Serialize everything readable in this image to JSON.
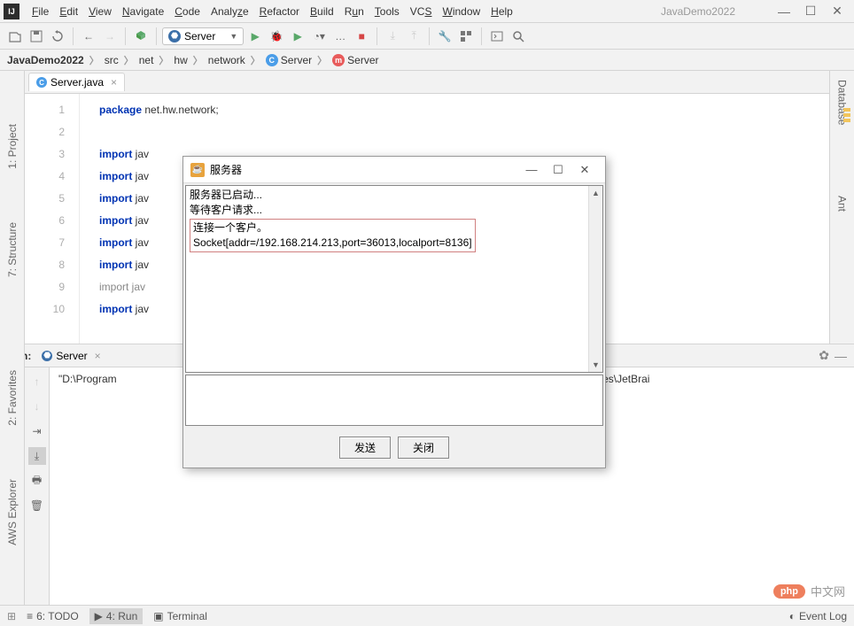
{
  "window": {
    "project_name": "JavaDemo2022"
  },
  "menu": {
    "file": "File",
    "edit": "Edit",
    "view": "View",
    "navigate": "Navigate",
    "code": "Code",
    "analyze": "Analyze",
    "refactor": "Refactor",
    "build": "Build",
    "run": "Run",
    "tools": "Tools",
    "vcs": "VCS",
    "window": "Window",
    "help": "Help"
  },
  "toolbar": {
    "run_config": "Server"
  },
  "breadcrumbs": {
    "root": "JavaDemo2022",
    "items": [
      "src",
      "net",
      "hw",
      "network"
    ],
    "class": "Server",
    "member": "Server"
  },
  "sidebars": {
    "project": "1: Project",
    "structure": "7: Structure",
    "favorites": "2: Favorites",
    "aws": "AWS Explorer",
    "database": "Database",
    "ant": "Ant"
  },
  "editor": {
    "tab_name": "Server.java",
    "lines": {
      "1": "package net.hw.network;",
      "3": "import jav",
      "4": "import jav",
      "5": "import jav",
      "6": "import jav",
      "7": "import jav",
      "8": "import jav",
      "9": "import jav",
      "10": "import jav"
    },
    "gutter_lines": [
      "1",
      "2",
      "3",
      "4",
      "5",
      "6",
      "7",
      "8",
      "9",
      "10"
    ]
  },
  "run_panel": {
    "title": "Run:",
    "tab": "Server",
    "output_left": "\"D:\\Program",
    "output_right": ":D:\\Program Files\\JetBrai"
  },
  "statusbar": {
    "todo": "6: TODO",
    "run": "4: Run",
    "terminal": "Terminal",
    "event_log": "Event Log"
  },
  "watermark": {
    "logo": "php",
    "text": "中文网"
  },
  "dialog": {
    "title": "服务器",
    "lines": {
      "l1": "服务器已启动...",
      "l2": "等待客户请求...",
      "l3": "连接一个客户。",
      "l4": "Socket[addr=/192.168.214.213,port=36013,localport=8136]"
    },
    "btn_send": "发送",
    "btn_close": "关闭"
  }
}
